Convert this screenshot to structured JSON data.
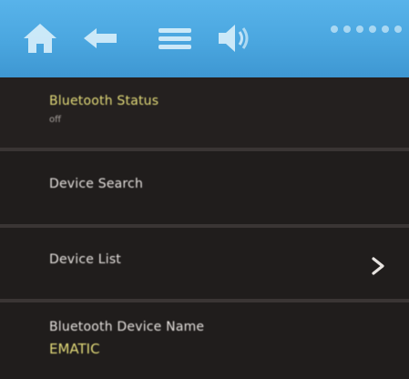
{
  "topbar": {
    "icons": [
      "home-icon",
      "back-arrow-icon",
      "menu-icon",
      "volume-icon"
    ],
    "dots_icon": "page-indicator-dots"
  },
  "colors": {
    "topbar": "#4aa6df",
    "background": "#1c1a19",
    "highlight_text": "#e4dc7a",
    "text": "#e6e2df"
  },
  "menu": {
    "bluetooth_status": {
      "label": "Bluetooth Status",
      "value": "off"
    },
    "device_search": {
      "label": "Device Search"
    },
    "device_list": {
      "label": "Device List",
      "chevron": ">"
    },
    "device_name": {
      "label": "Bluetooth Device Name",
      "value": "EMATIC"
    }
  }
}
